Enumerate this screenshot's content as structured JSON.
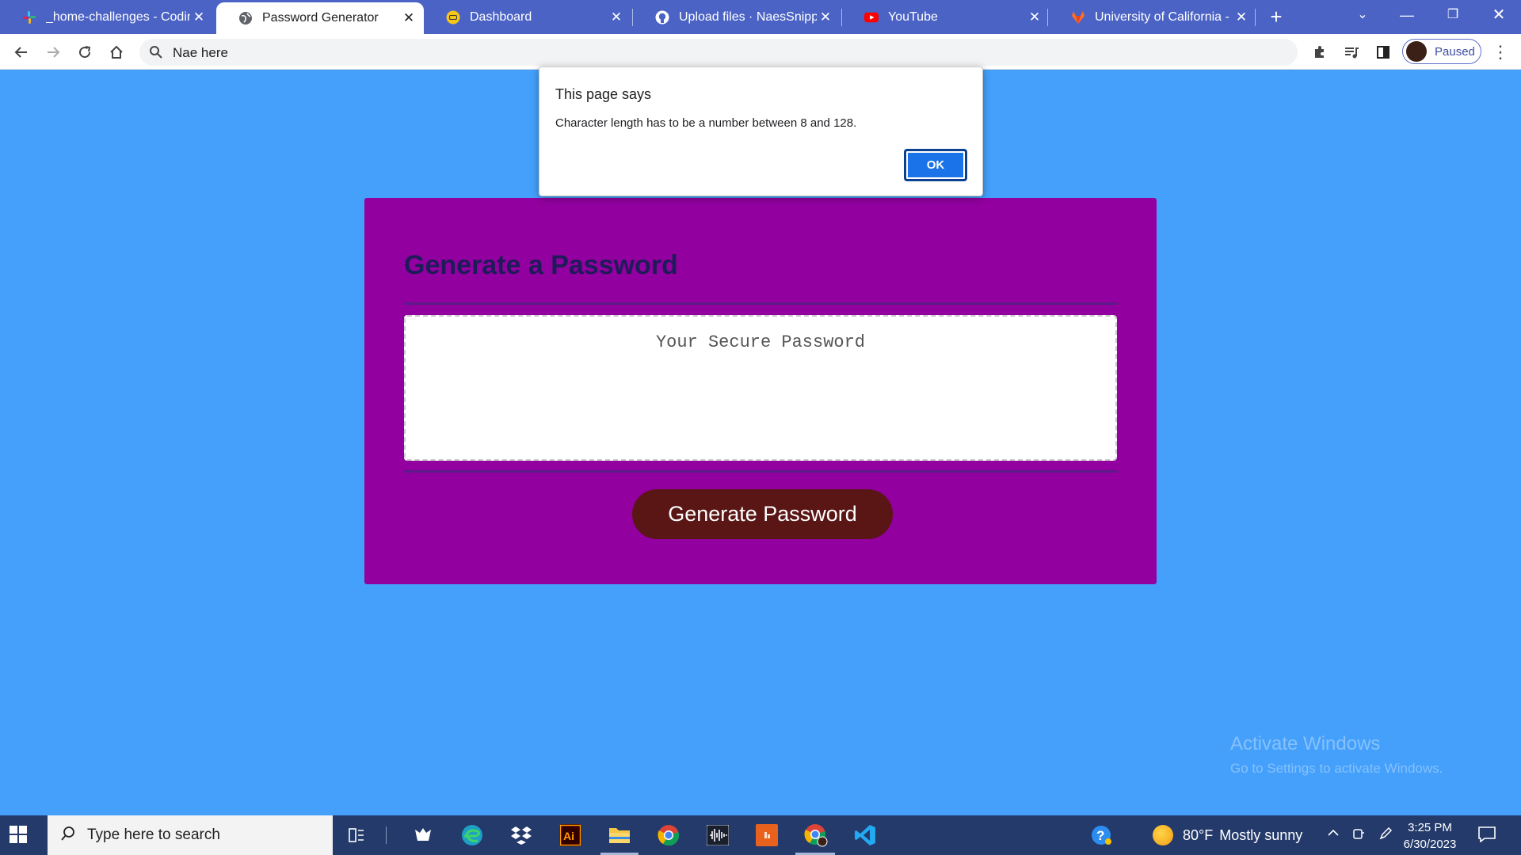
{
  "browser": {
    "tabs": [
      {
        "title": "_home-challenges - Coding",
        "favicon": "slack-icon",
        "active": false
      },
      {
        "title": "Password Generator",
        "favicon": "globe-icon",
        "active": true
      },
      {
        "title": "Dashboard",
        "favicon": "dashboard-icon",
        "active": false
      },
      {
        "title": "Upload files · NaesSnippit/c",
        "favicon": "github-icon",
        "active": false
      },
      {
        "title": "YouTube",
        "favicon": "youtube-icon",
        "active": false
      },
      {
        "title": "University of California - Be",
        "favicon": "gitlab-icon",
        "active": false
      }
    ],
    "address": "Nae here",
    "profile_status": "Paused"
  },
  "page": {
    "heading": "Generate a Password",
    "password_placeholder": "Your Secure Password",
    "generate_button": "Generate Password",
    "colors": {
      "background": "#44a0fb",
      "card": "#92009f",
      "heading": "#1f1b5a",
      "button": "#5a1515"
    }
  },
  "dialog": {
    "title": "This page says",
    "message": "Character length has to be a number between 8 and 128.",
    "ok_label": "OK"
  },
  "watermark": {
    "line1": "Activate Windows",
    "line2": "Go to Settings to activate Windows."
  },
  "taskbar": {
    "search_placeholder": "Type here to search",
    "apps": [
      "task-view-icon",
      "app-icon",
      "edge-icon",
      "dropbox-icon",
      "illustrator-icon",
      "file-explorer-icon",
      "chrome-icon",
      "audio-icon",
      "powerpoint-icon",
      "chrome-profile-icon",
      "vscode-icon"
    ],
    "temperature": "80°F",
    "weather": "Mostly sunny",
    "time": "3:25 PM",
    "date": "6/30/2023"
  }
}
